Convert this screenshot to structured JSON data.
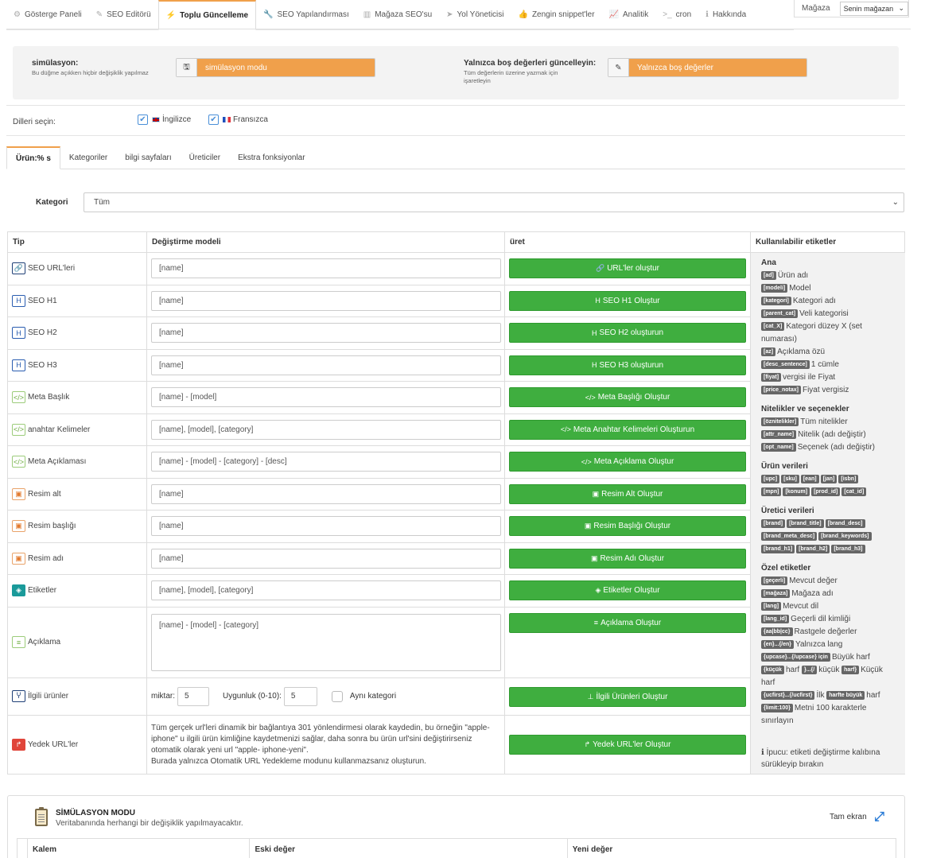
{
  "nav": {
    "items": [
      {
        "label": "Gösterge Paneli",
        "icon": "dashboard-icon",
        "glyph": "⚙"
      },
      {
        "label": "SEO Editörü",
        "icon": "edit-icon",
        "glyph": "✎"
      },
      {
        "label": "Toplu Güncelleme",
        "icon": "bolt-icon",
        "glyph": "⚡"
      },
      {
        "label": "SEO Yapılandırması",
        "icon": "wrench-icon",
        "glyph": "🔧"
      },
      {
        "label": "Mağaza SEO'su",
        "icon": "chart-icon",
        "glyph": "▥"
      },
      {
        "label": "Yol Yöneticisi",
        "icon": "location-icon",
        "glyph": "➤"
      },
      {
        "label": "Zengin snippet'ler",
        "icon": "thumbs-up-icon",
        "glyph": "👍"
      },
      {
        "label": "Analitik",
        "icon": "line-chart-icon",
        "glyph": "📈"
      },
      {
        "label": "cron",
        "icon": "terminal-icon",
        "glyph": ">_"
      },
      {
        "label": "Hakkında",
        "icon": "info-icon",
        "glyph": "ℹ"
      }
    ],
    "active_index": 2
  },
  "store": {
    "label": "Mağaza",
    "value": "Senin mağazan"
  },
  "simulation": {
    "label": "simülasyon:",
    "sub": "Bu düğme açıkken hiçbir değişiklik yapılmaz",
    "button": "simülasyon modu"
  },
  "empty_only": {
    "label": "Yalnızca boş değerleri güncelleyin:",
    "sub": "Tüm değerlerin üzerine yazmak için işaretleyin",
    "button": "Yalnızca boş değerler"
  },
  "languages": {
    "label": "Dilleri seçin:",
    "items": [
      {
        "label": "İngilizce",
        "checked": true
      },
      {
        "label": "Fransızca",
        "checked": true
      }
    ]
  },
  "tabs": [
    "Ürün:% s",
    "Kategoriler",
    "bilgi sayfaları",
    "Üreticiler",
    "Ekstra fonksiyonlar"
  ],
  "category": {
    "label": "Kategori",
    "value": "Tüm"
  },
  "table": {
    "headers": [
      "Tip",
      "Değiştirme modeli",
      "üret",
      "Kullanılabilir etiketler"
    ],
    "rows": [
      {
        "type": "SEO URL'leri",
        "icon": "link-icon",
        "glyph": "🔗",
        "color": "navy",
        "pattern": "[name]",
        "button": "URL'ler oluştur",
        "bicon": "🔗"
      },
      {
        "type": "SEO H1",
        "icon": "header-icon",
        "glyph": "H",
        "color": "blue",
        "pattern": "[name]",
        "button": "SEO H1 Oluştur",
        "bicon": "H"
      },
      {
        "type": "SEO H2",
        "icon": "header-icon",
        "glyph": "H",
        "color": "blue",
        "pattern": "[name]",
        "button": "SEO H2 oluşturun",
        "bicon": "H"
      },
      {
        "type": "SEO H3",
        "icon": "header-icon",
        "glyph": "H",
        "color": "blue",
        "pattern": "[name]",
        "button": "SEO H3 oluşturun",
        "bicon": "H"
      },
      {
        "type": "Meta Başlık",
        "icon": "code-icon",
        "glyph": "</>",
        "color": "green",
        "pattern": "[name] - [model]",
        "button": "Meta Başlığı Oluştur",
        "bicon": "</>"
      },
      {
        "type": "anahtar Kelimeler",
        "icon": "code-icon",
        "glyph": "</>",
        "color": "green",
        "pattern": "[name], [model], [category]",
        "button": "Meta Anahtar Kelimeleri Oluşturun",
        "bicon": "</>"
      },
      {
        "type": "Meta Açıklaması",
        "icon": "code-icon",
        "glyph": "</>",
        "color": "green",
        "pattern": "[name] - [model] - [category] - [desc]",
        "button": "Meta Açıklama Oluştur",
        "bicon": "</>"
      },
      {
        "type": "Resim alt",
        "icon": "image-icon",
        "glyph": "▣",
        "color": "orange",
        "pattern": "[name]",
        "button": "Resim Alt Oluştur",
        "bicon": "▣"
      },
      {
        "type": "Resim başlığı",
        "icon": "image-icon",
        "glyph": "▣",
        "color": "orange",
        "pattern": "[name]",
        "button": "Resim Başlığı Oluştur",
        "bicon": "▣"
      },
      {
        "type": "Resim adı",
        "icon": "image-icon",
        "glyph": "▣",
        "color": "orange",
        "pattern": "[name]",
        "button": "Resim Adı Oluştur",
        "bicon": "▣"
      },
      {
        "type": "Etiketler",
        "icon": "tag-icon",
        "glyph": "◈",
        "color": "teal",
        "pattern": "[name], [model], [category]",
        "button": "Etiketler Oluştur",
        "bicon": "◈"
      }
    ],
    "description": {
      "type": "Açıklama",
      "pattern": "[name] - [model] - [category]",
      "button": "Açıklama Oluştur"
    },
    "related": {
      "type": "İlgili ürünler",
      "qty_label": "miktar:",
      "qty": "5",
      "rel_label": "Uygunluk (0-10):",
      "rel": "5",
      "same_cat": "Aynı kategori",
      "button": "İlgili Ürünleri Oluştur"
    },
    "backup": {
      "type": "Yedek URL'ler",
      "text1": "Tüm gerçek url'leri dinamik bir bağlantıya 301 yönlendirmesi olarak kaydedin, bu örneğin \"apple-iphone\" u ilgili ürün kimliğine kaydetmenizi sağlar, daha sonra bu ürün url'sini değiştirirseniz otomatik olarak yeni url \"apple- iphone-yeni\".",
      "text2": "Burada yalnızca Otomatik URL Yedekleme modunu kullanmazsanız oluşturun.",
      "button": "Yedek URL'ler Oluştur"
    }
  },
  "tags": {
    "ana": {
      "title": "Ana",
      "items": [
        {
          "tag": "[ad]",
          "desc": "Ürün adı"
        },
        {
          "tag": "[modeli]",
          "desc": "Model"
        },
        {
          "tag": "[kategori]",
          "desc": "Kategori adı"
        },
        {
          "tag": "[parent_cat]",
          "desc": "Veli kategorisi"
        },
        {
          "tag": "[cat_X]",
          "desc": "Kategori düzey X (set numarası)"
        },
        {
          "tag": "[az]",
          "desc": "Açıklama özü"
        },
        {
          "tag": "[desc_sentence]",
          "desc": "1 cümle"
        },
        {
          "tag": "[fiyat]",
          "desc": "vergisi ile Fiyat"
        },
        {
          "tag": "[price_notax]",
          "desc": "Fiyat vergisiz"
        }
      ]
    },
    "attrs": {
      "title": "Nitelikler ve seçenekler",
      "items": [
        {
          "tag": "[öznitelikler]",
          "desc": "Tüm nitelikler"
        },
        {
          "tag": "[attr_name]",
          "desc": "Nitelik (adı değiştir)"
        },
        {
          "tag": "[opt_name]",
          "desc": "Seçenek (adı değiştir)"
        }
      ]
    },
    "product": {
      "title": "Ürün verileri",
      "line1": [
        "[upc]",
        "[sku]",
        "[ean]",
        "[jan]",
        "[isbn]"
      ],
      "line2": [
        "[mpn]",
        "[konum]",
        "[prod_id]",
        "[cat_id]"
      ]
    },
    "brand": {
      "title": "Üretici verileri",
      "line1": [
        "[brand]",
        "[brand_title]",
        "[brand_desc]"
      ],
      "line2": [
        "[brand_meta_desc]",
        "[brand_keywords]"
      ],
      "line3": [
        "[brand_h1]",
        "[brand_h2]",
        "[brand_h3]"
      ]
    },
    "special": {
      "title": "Özel etiketler",
      "items": [
        {
          "tag": "[geçerli]",
          "desc": "Mevcut değer"
        },
        {
          "tag": "[mağaza]",
          "desc": "Mağaza adı"
        },
        {
          "tag": "[lang]",
          "desc": "Mevcut dil"
        },
        {
          "tag": "[lang_id]",
          "desc": "Geçerli dil kimliği"
        },
        {
          "tag": "{aa|bb|cc}",
          "desc": "Rastgele değerler"
        },
        {
          "tag": "{en}...{/en}",
          "desc": "Yalnızca lang"
        },
        {
          "tag": "{upcase}...{/upcase} için",
          "desc": "Büyük harf"
        }
      ],
      "lower": {
        "t1": "{küçük",
        "w1": "harf",
        "t2": "}...{/",
        "w2": "küçük",
        "t3": "harf}",
        "w3": "Küçük harf"
      },
      "ucfirst": {
        "t1": "{ucfirst}...{/ucfirst}",
        "w1": "İlk",
        "t2": "harfte büyük",
        "w2": "harf"
      },
      "limit": {
        "t1": "{limit:100}",
        "w1": "Metni 100 karakterle sınırlayın"
      }
    },
    "tip": "İpucu: etiketi değiştirme kalıbına sürükleyip bırakın"
  },
  "sim_panel": {
    "title": "SİMÜLASYON MODU",
    "sub": "Veritabanında herhangi bir değişiklik yapılmayacaktır.",
    "fullscreen": "Tam ekran",
    "headers": [
      "Kalem",
      "Eski değer",
      "Yeni değer"
    ]
  }
}
